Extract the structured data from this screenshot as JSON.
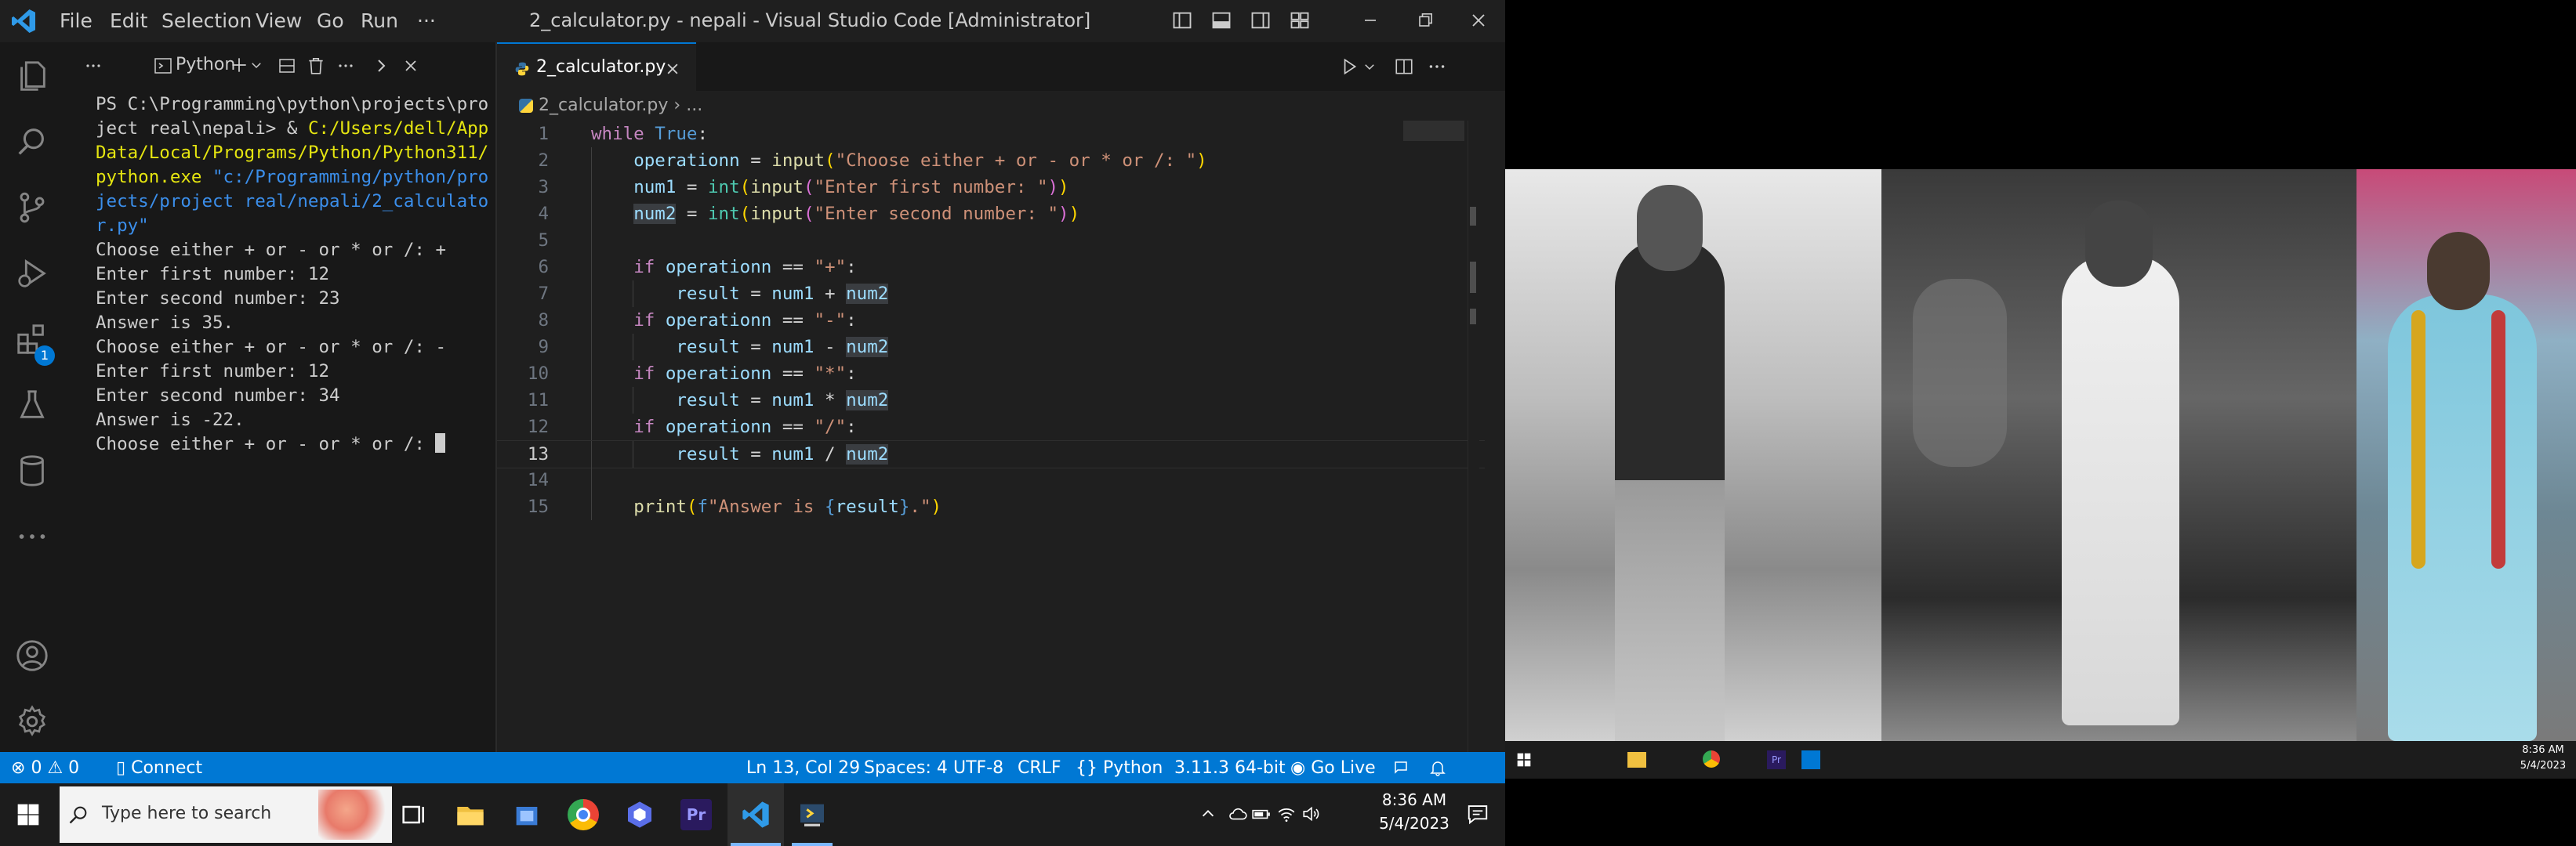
{
  "window": {
    "menus": [
      "File",
      "Edit",
      "Selection",
      "View",
      "Go",
      "Run",
      "···"
    ],
    "title": "2_calculator.py - nepali - Visual Studio Code [Administrator]",
    "extensions_badge": "1"
  },
  "panel": {
    "terminal_name": "Python",
    "lines": [
      {
        "segments": [
          {
            "t": "PS C:\\Programming\\python\\projects\\pro",
            "k": "n"
          }
        ]
      },
      {
        "segments": [
          {
            "t": "ject real\\nepali> & ",
            "k": "n"
          },
          {
            "t": "C:/Users/dell/App",
            "k": "y"
          }
        ]
      },
      {
        "segments": [
          {
            "t": "Data/Local/Programs/Python/Python311/",
            "k": "y"
          }
        ]
      },
      {
        "segments": [
          {
            "t": "python.exe ",
            "k": "y"
          },
          {
            "t": "\"c:/Programming/python/pro",
            "k": "c"
          }
        ]
      },
      {
        "segments": [
          {
            "t": "jects/project real/nepali/2_calculato",
            "k": "c"
          }
        ]
      },
      {
        "segments": [
          {
            "t": "r.py\"",
            "k": "c"
          }
        ]
      },
      {
        "segments": [
          {
            "t": "Choose either + or - or * or /: +",
            "k": "n"
          }
        ]
      },
      {
        "segments": [
          {
            "t": "Enter first number: 12",
            "k": "n"
          }
        ]
      },
      {
        "segments": [
          {
            "t": "Enter second number: 23",
            "k": "n"
          }
        ]
      },
      {
        "segments": [
          {
            "t": "Answer is 35.",
            "k": "n"
          }
        ]
      },
      {
        "segments": [
          {
            "t": "Choose either + or - or * or /: -",
            "k": "n"
          }
        ]
      },
      {
        "segments": [
          {
            "t": "Enter first number: 12",
            "k": "n"
          }
        ]
      },
      {
        "segments": [
          {
            "t": "Enter second number: 34",
            "k": "n"
          }
        ]
      },
      {
        "segments": [
          {
            "t": "Answer is -22.",
            "k": "n"
          }
        ]
      },
      {
        "segments": [
          {
            "t": "Choose either + or - or * or /: ",
            "k": "n"
          }
        ]
      }
    ]
  },
  "editor": {
    "tab_label": "2_calculator.py",
    "breadcrumb_file": "2_calculator.py",
    "breadcrumb_more": "...",
    "code": [
      {
        "n": "1",
        "seg": [
          [
            "kw",
            "while"
          ],
          [
            "op",
            " "
          ],
          [
            "bl",
            "True"
          ],
          [
            "op",
            ":"
          ]
        ]
      },
      {
        "n": "2",
        "seg": [
          [
            "op",
            "    "
          ],
          [
            "va",
            "operationn"
          ],
          [
            "op",
            " = "
          ],
          [
            "fn",
            "input"
          ],
          [
            "br",
            "("
          ],
          [
            "st",
            "\"Choose either + or - or * or /: \""
          ],
          [
            "br",
            ")"
          ]
        ]
      },
      {
        "n": "3",
        "seg": [
          [
            "op",
            "    "
          ],
          [
            "va",
            "num1"
          ],
          [
            "op",
            " = "
          ],
          [
            "cl",
            "int"
          ],
          [
            "br",
            "("
          ],
          [
            "fn",
            "input"
          ],
          [
            "br2",
            "("
          ],
          [
            "st",
            "\"Enter first number: \""
          ],
          [
            "br2",
            ")"
          ],
          [
            "br",
            ")"
          ]
        ]
      },
      {
        "n": "4",
        "seg": [
          [
            "op",
            "    "
          ],
          [
            "va hl",
            "num2"
          ],
          [
            "op",
            " = "
          ],
          [
            "cl",
            "int"
          ],
          [
            "br",
            "("
          ],
          [
            "fn",
            "input"
          ],
          [
            "br2",
            "("
          ],
          [
            "st",
            "\"Enter second number: \""
          ],
          [
            "br2",
            ")"
          ],
          [
            "br",
            ")"
          ]
        ]
      },
      {
        "n": "5",
        "seg": []
      },
      {
        "n": "6",
        "seg": [
          [
            "op",
            "    "
          ],
          [
            "kw",
            "if"
          ],
          [
            "op",
            " "
          ],
          [
            "va",
            "operationn"
          ],
          [
            "op",
            " == "
          ],
          [
            "st",
            "\"+\""
          ],
          [
            "op",
            ":"
          ]
        ]
      },
      {
        "n": "7",
        "seg": [
          [
            "op",
            "        "
          ],
          [
            "va",
            "result"
          ],
          [
            "op",
            " = "
          ],
          [
            "va",
            "num1"
          ],
          [
            "op",
            " + "
          ],
          [
            "va hl",
            "num2"
          ]
        ]
      },
      {
        "n": "8",
        "seg": [
          [
            "op",
            "    "
          ],
          [
            "kw",
            "if"
          ],
          [
            "op",
            " "
          ],
          [
            "va",
            "operationn"
          ],
          [
            "op",
            " == "
          ],
          [
            "st",
            "\"-\""
          ],
          [
            "op",
            ":"
          ]
        ]
      },
      {
        "n": "9",
        "seg": [
          [
            "op",
            "        "
          ],
          [
            "va",
            "result"
          ],
          [
            "op",
            " = "
          ],
          [
            "va",
            "num1"
          ],
          [
            "op",
            " - "
          ],
          [
            "va hl",
            "num2"
          ]
        ]
      },
      {
        "n": "10",
        "seg": [
          [
            "op",
            "    "
          ],
          [
            "kw",
            "if"
          ],
          [
            "op",
            " "
          ],
          [
            "va",
            "operationn"
          ],
          [
            "op",
            " == "
          ],
          [
            "st",
            "\"*\""
          ],
          [
            "op",
            ":"
          ]
        ]
      },
      {
        "n": "11",
        "seg": [
          [
            "op",
            "        "
          ],
          [
            "va",
            "result"
          ],
          [
            "op",
            " = "
          ],
          [
            "va",
            "num1"
          ],
          [
            "op",
            " * "
          ],
          [
            "va hl",
            "num2"
          ]
        ]
      },
      {
        "n": "12",
        "seg": [
          [
            "op",
            "    "
          ],
          [
            "kw",
            "if"
          ],
          [
            "op",
            " "
          ],
          [
            "va",
            "operationn"
          ],
          [
            "op",
            " == "
          ],
          [
            "st",
            "\"/\""
          ],
          [
            "op",
            ":"
          ]
        ]
      },
      {
        "n": "13",
        "seg": [
          [
            "op",
            "        "
          ],
          [
            "va",
            "result"
          ],
          [
            "op",
            " = "
          ],
          [
            "va",
            "num1"
          ],
          [
            "op",
            " / "
          ],
          [
            "va hl",
            "num2"
          ]
        ]
      },
      {
        "n": "14",
        "seg": []
      },
      {
        "n": "15",
        "seg": [
          [
            "op",
            "    "
          ],
          [
            "fn",
            "print"
          ],
          [
            "br",
            "("
          ],
          [
            "bl",
            "f"
          ],
          [
            "st",
            "\"Answer is "
          ],
          [
            "bl",
            "{"
          ],
          [
            "va",
            "result"
          ],
          [
            "bl",
            "}"
          ],
          [
            "st",
            ".\""
          ],
          [
            "br",
            ")"
          ]
        ]
      }
    ]
  },
  "status": {
    "errors": "0",
    "warnings": "0",
    "connect": "Connect",
    "position": "Ln 13, Col 29",
    "spaces": "Spaces: 4",
    "encoding": "UTF-8",
    "eol": "CRLF",
    "language": "Python",
    "interpreter": "3.11.3 64-bit",
    "golive": "Go Live"
  },
  "taskbar": {
    "search_placeholder": "Type here to search",
    "time": "8:36 AM",
    "date": "5/4/2023"
  },
  "photo_taskbar": {
    "time": "8:36 AM",
    "date": "5/4/2023"
  },
  "colors": {
    "accent": "#0078d4",
    "editor_bg": "#1f1f1f",
    "panel_bg": "#181818"
  }
}
